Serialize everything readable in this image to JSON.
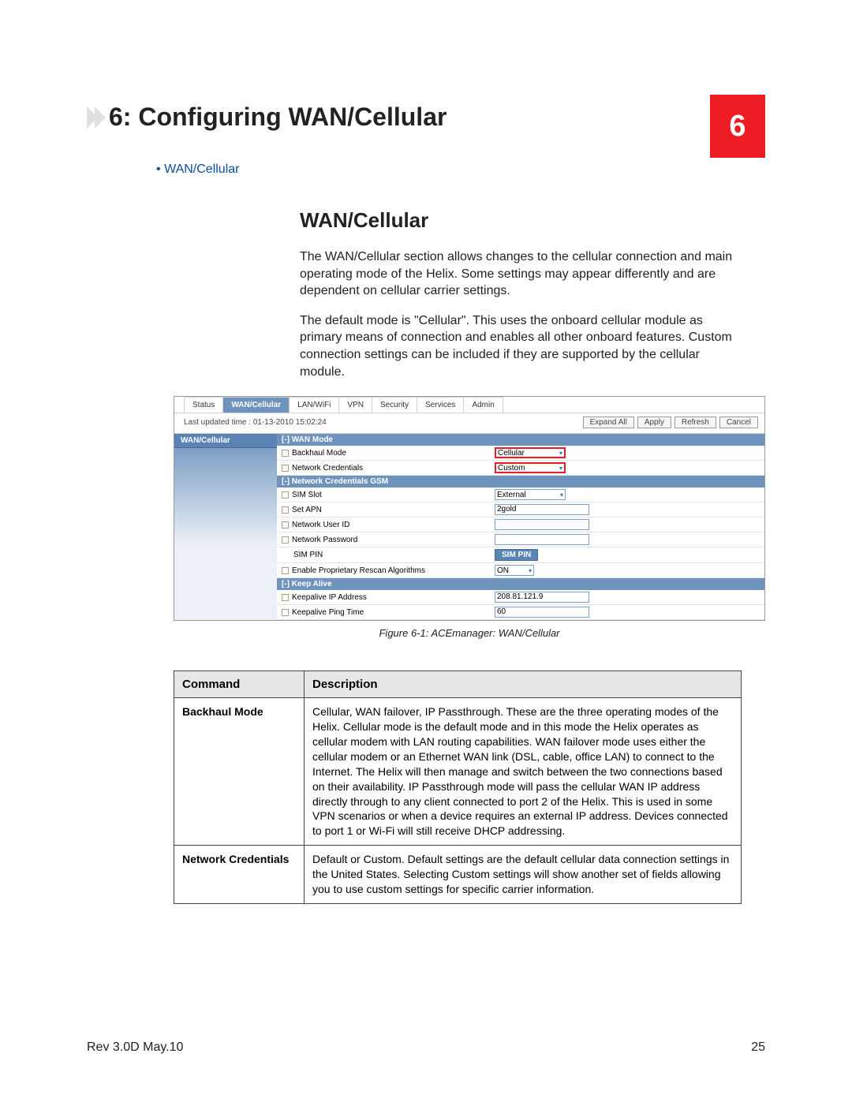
{
  "chapter": {
    "number": "6",
    "title": "6: Configuring WAN/Cellular"
  },
  "toc": {
    "bullet": "•",
    "item": "WAN/Cellular"
  },
  "section": {
    "heading": "WAN/Cellular",
    "para1": "The WAN/Cellular section allows changes to the cellular connection and main operating mode of the Helix. Some settings may appear differently and are dependent on cellular carrier settings.",
    "para2": "The default mode is \"Cellular\". This uses the onboard cellular module as primary means of connection and enables all other onboard features. Custom connection settings can be included if they are supported by the cellular module."
  },
  "screenshot": {
    "tabs": [
      "Status",
      "WAN/Cellular",
      "LAN/WiFi",
      "VPN",
      "Security",
      "Services",
      "Admin"
    ],
    "active_tab_index": 1,
    "last_updated": "Last updated time : 01-13-2010 15:02:24",
    "buttons": [
      "Expand All",
      "Apply",
      "Refresh",
      "Cancel"
    ],
    "side_item": "WAN/Cellular",
    "groups": [
      {
        "title": "[-] WAN Mode",
        "rows": [
          {
            "label": "Backhaul Mode",
            "ctrl": "select",
            "value": "Cellular",
            "highlight": true
          },
          {
            "label": "Network Credentials",
            "ctrl": "select",
            "value": "Custom",
            "highlight": true
          }
        ]
      },
      {
        "title": "[-] Network Credentials GSM",
        "rows": [
          {
            "label": "SIM Slot",
            "ctrl": "select",
            "value": "External"
          },
          {
            "label": "Set APN",
            "ctrl": "input",
            "value": "2gold"
          },
          {
            "label": "Network User ID",
            "ctrl": "input",
            "value": ""
          },
          {
            "label": "Network Password",
            "ctrl": "input",
            "value": ""
          },
          {
            "label": "SIM PIN",
            "ctrl": "simpin",
            "value": "SIM PIN",
            "nobox": true
          },
          {
            "label": "Enable Proprietary Rescan Algorithms",
            "ctrl": "select_short",
            "value": "ON"
          }
        ]
      },
      {
        "title": "[-] Keep Alive",
        "rows": [
          {
            "label": "Keepalive IP Address",
            "ctrl": "input",
            "value": "208.81.121.9"
          },
          {
            "label": "Keepalive Ping Time",
            "ctrl": "input",
            "value": "60"
          }
        ]
      }
    ]
  },
  "figure_caption": "Figure 6-1: ACEmanager: WAN/Cellular",
  "table": {
    "headers": [
      "Command",
      "Description"
    ],
    "rows": [
      {
        "command": "Backhaul Mode",
        "description": "Cellular, WAN failover, IP Passthrough. These are the three operating modes of the Helix. Cellular mode is the default mode and in this mode the Helix operates as cellular modem with LAN routing capabilities. WAN failover mode uses either the cellular modem or an Ethernet WAN link (DSL, cable, office LAN) to connect to the Internet. The Helix will then manage and switch between the two connections based on their availability. IP Passthrough mode will pass the cellular WAN IP address directly through to any client connected to port 2 of the Helix. This is used in some VPN scenarios or when a device requires an external IP address. Devices connected to port 1 or Wi-Fi will still receive DHCP addressing."
      },
      {
        "command": "Network Credentials",
        "description": "Default or Custom. Default settings are the default cellular data connection settings in the United States. Selecting Custom settings will show another set of fields allowing you to use custom settings for specific carrier information."
      }
    ]
  },
  "footer": {
    "left": "Rev 3.0D  May.10",
    "right": "25"
  }
}
